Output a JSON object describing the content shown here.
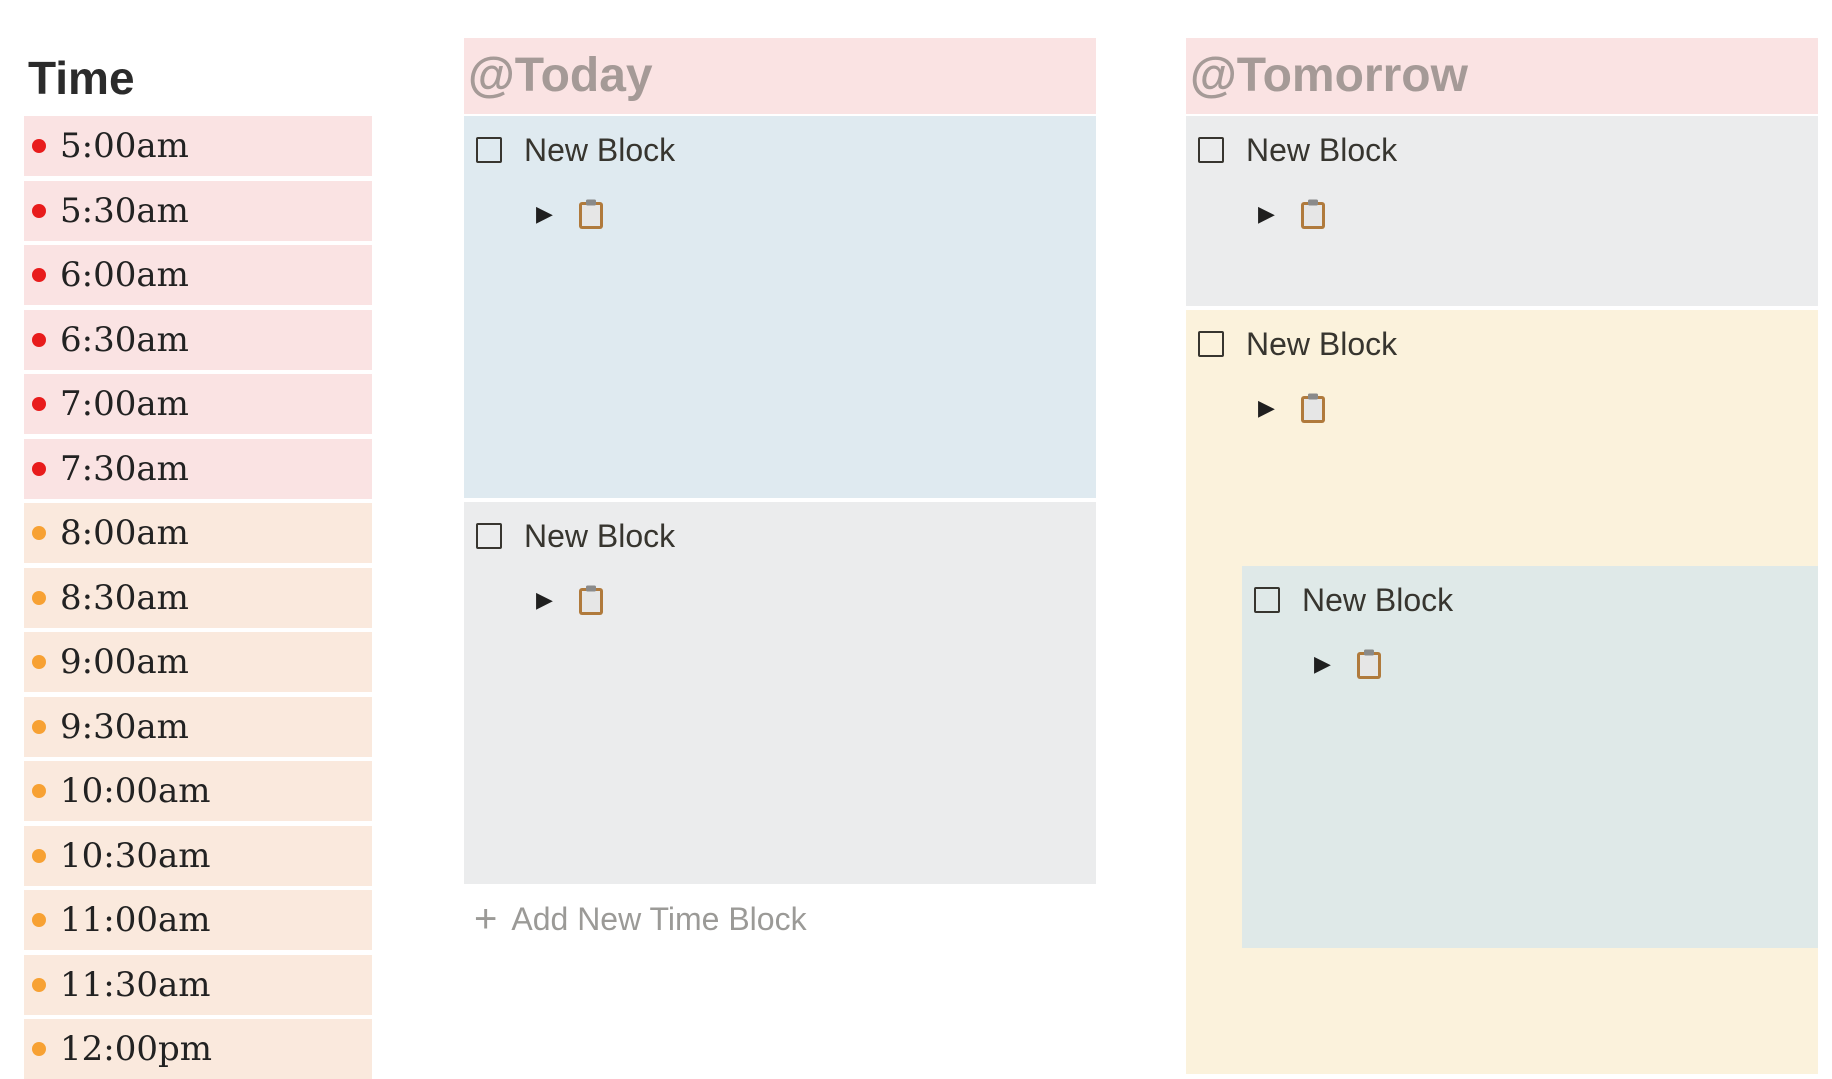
{
  "time_column": {
    "title": "Time",
    "slots": [
      {
        "label": "5:00am",
        "dot_color": "#e81c1c",
        "bg": "#fae3e3"
      },
      {
        "label": "5:30am",
        "dot_color": "#e81c1c",
        "bg": "#fae3e3"
      },
      {
        "label": "6:00am",
        "dot_color": "#e81c1c",
        "bg": "#fae3e3"
      },
      {
        "label": "6:30am",
        "dot_color": "#e81c1c",
        "bg": "#fae3e3"
      },
      {
        "label": "7:00am",
        "dot_color": "#e81c1c",
        "bg": "#fae3e3"
      },
      {
        "label": "7:30am",
        "dot_color": "#e81c1c",
        "bg": "#fae3e3"
      },
      {
        "label": "8:00am",
        "dot_color": "#f7a133",
        "bg": "#fae9dd"
      },
      {
        "label": "8:30am",
        "dot_color": "#f7a133",
        "bg": "#fae9dd"
      },
      {
        "label": "9:00am",
        "dot_color": "#f7a133",
        "bg": "#fae9dd"
      },
      {
        "label": "9:30am",
        "dot_color": "#f7a133",
        "bg": "#fae9dd"
      },
      {
        "label": "10:00am",
        "dot_color": "#f7a133",
        "bg": "#fae9dd"
      },
      {
        "label": "10:30am",
        "dot_color": "#f7a133",
        "bg": "#fae9dd"
      },
      {
        "label": "11:00am",
        "dot_color": "#f7a133",
        "bg": "#fae9dd"
      },
      {
        "label": "11:30am",
        "dot_color": "#f7a133",
        "bg": "#fae9dd"
      },
      {
        "label": "12:00pm",
        "dot_color": "#f7a133",
        "bg": "#fae9dd"
      }
    ]
  },
  "today": {
    "header": "@Today",
    "header_bg": "#fae3e3",
    "blocks": [
      {
        "label": "New Block",
        "bg": "#dfeaf0",
        "sub_icon": "clipboard-icon"
      },
      {
        "label": "New Block",
        "bg": "#ebeced",
        "sub_icon": "clipboard-icon"
      }
    ],
    "add_label": "Add New Time Block"
  },
  "tomorrow": {
    "header": "@Tomorrow",
    "header_bg": "#fae3e3",
    "blocks": [
      {
        "label": "New Block",
        "bg": "#ebeced",
        "sub_icon": "clipboard-icon"
      },
      {
        "label": "New Block",
        "bg": "#fbf2dc",
        "sub_icon": "clipboard-icon"
      },
      {
        "label": "New Block",
        "bg": "#dfe9e8",
        "sub_icon": "clipboard-icon"
      }
    ]
  }
}
